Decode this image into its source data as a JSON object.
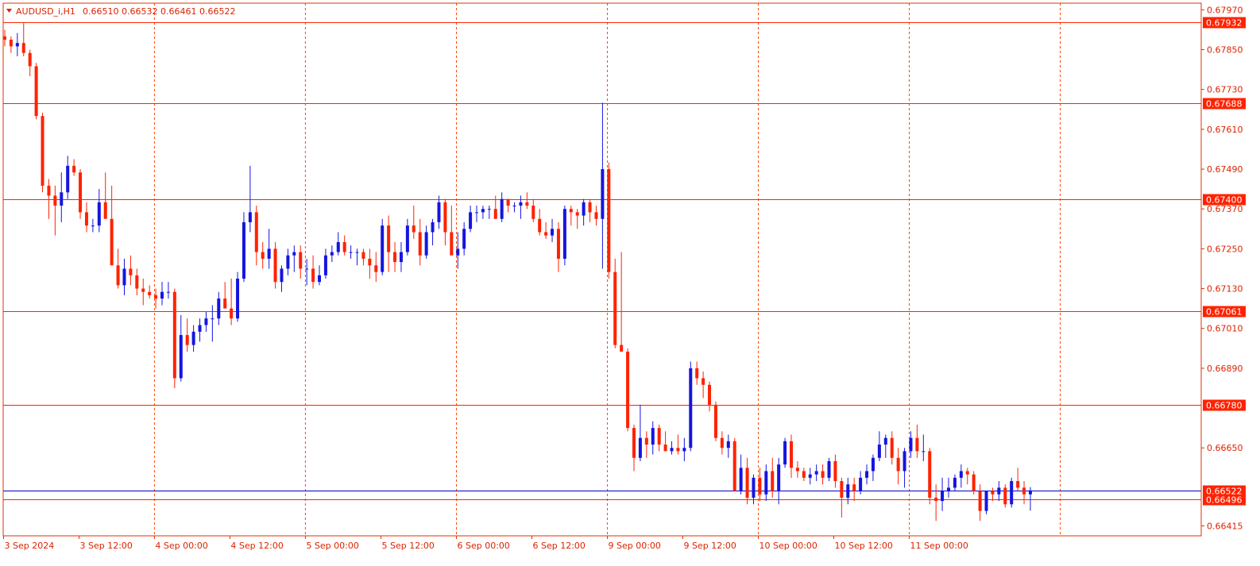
{
  "header": {
    "symbol_label": "AUDUSD_i,H1",
    "ohlc_label": "0.66510 0.66532 0.66461 0.66522"
  },
  "colors": {
    "bull": "#1515e0",
    "bear": "#ff2200",
    "axis_text": "#dd2200",
    "hline": "#ff2200",
    "grid": "#ff4400",
    "bid_line": "#0000cc"
  },
  "chart_data": {
    "type": "candlestick",
    "title": "AUDUSD_i,H1",
    "ylim": [
      0.66385,
      0.6799
    ],
    "x_tick_labels": [
      "3 Sep 2024",
      "3 Sep 12:00",
      "4 Sep 00:00",
      "4 Sep 12:00",
      "5 Sep 00:00",
      "5 Sep 12:00",
      "6 Sep 00:00",
      "6 Sep 12:00",
      "9 Sep 00:00",
      "9 Sep 12:00",
      "10 Sep 00:00",
      "10 Sep 12:00",
      "11 Sep 00:00"
    ],
    "y_tick_labels": [
      "0.67970",
      "0.67850",
      "0.67730",
      "0.67610",
      "0.67490",
      "0.67370",
      "0.67250",
      "0.67130",
      "0.67010",
      "0.66890",
      "0.66650",
      "0.66415"
    ],
    "y_tick_values": [
      0.6797,
      0.6785,
      0.6773,
      0.6761,
      0.6749,
      0.6737,
      0.6725,
      0.6713,
      0.6701,
      0.6689,
      0.6665,
      0.66415
    ],
    "horizontal_levels": [
      {
        "label": "0.67932",
        "value": 0.67932
      },
      {
        "label": "0.67688",
        "value": 0.67688
      },
      {
        "label": "0.67400",
        "value": 0.674
      },
      {
        "label": "0.67061",
        "value": 0.67061
      },
      {
        "label": "0.66780",
        "value": 0.6678
      },
      {
        "label": "0.66496",
        "value": 0.66496
      }
    ],
    "current_price": {
      "label": "0.66522",
      "value": 0.66522
    },
    "candles": [
      [
        0.6789,
        0.6791,
        0.6786,
        0.6788
      ],
      [
        0.6788,
        0.6789,
        0.6784,
        0.6786
      ],
      [
        0.6786,
        0.679,
        0.6783,
        0.6787
      ],
      [
        0.6787,
        0.6793,
        0.6783,
        0.6784
      ],
      [
        0.6784,
        0.6785,
        0.6777,
        0.678
      ],
      [
        0.678,
        0.6781,
        0.6764,
        0.6765
      ],
      [
        0.6765,
        0.6766,
        0.6742,
        0.6744
      ],
      [
        0.6744,
        0.6746,
        0.6734,
        0.6741
      ],
      [
        0.6741,
        0.6744,
        0.6729,
        0.6738
      ],
      [
        0.6738,
        0.6748,
        0.6733,
        0.6742
      ],
      [
        0.6742,
        0.6753,
        0.674,
        0.675
      ],
      [
        0.675,
        0.6752,
        0.6747,
        0.6748
      ],
      [
        0.6748,
        0.6749,
        0.6734,
        0.6736
      ],
      [
        0.6736,
        0.6739,
        0.673,
        0.6732
      ],
      [
        0.6732,
        0.6734,
        0.673,
        0.6732
      ],
      [
        0.6732,
        0.6743,
        0.673,
        0.6739
      ],
      [
        0.6739,
        0.6748,
        0.6738,
        0.6734
      ],
      [
        0.6734,
        0.6744,
        0.673,
        0.672
      ],
      [
        0.672,
        0.6725,
        0.6713,
        0.6714
      ],
      [
        0.6714,
        0.6722,
        0.6711,
        0.6719
      ],
      [
        0.6719,
        0.6723,
        0.6714,
        0.6717
      ],
      [
        0.6717,
        0.6719,
        0.6711,
        0.6713
      ],
      [
        0.6713,
        0.6716,
        0.6708,
        0.6712
      ],
      [
        0.6712,
        0.6714,
        0.671,
        0.6711
      ],
      [
        0.6711,
        0.6713,
        0.6707,
        0.671
      ],
      [
        0.671,
        0.6715,
        0.6708,
        0.6712
      ],
      [
        0.6712,
        0.6715,
        0.671,
        0.6712
      ],
      [
        0.6712,
        0.6713,
        0.6683,
        0.6686
      ],
      [
        0.6686,
        0.6705,
        0.6685,
        0.6699
      ],
      [
        0.6699,
        0.6704,
        0.6694,
        0.6696
      ],
      [
        0.6696,
        0.6702,
        0.6694,
        0.67
      ],
      [
        0.67,
        0.6704,
        0.6697,
        0.6702
      ],
      [
        0.6702,
        0.6706,
        0.67,
        0.6704
      ],
      [
        0.6704,
        0.6708,
        0.6697,
        0.6704
      ],
      [
        0.6704,
        0.6712,
        0.6702,
        0.671
      ],
      [
        0.671,
        0.6715,
        0.6708,
        0.6707
      ],
      [
        0.6707,
        0.6716,
        0.6702,
        0.6704
      ],
      [
        0.6704,
        0.6718,
        0.6703,
        0.6716
      ],
      [
        0.6716,
        0.6736,
        0.6715,
        0.6733
      ],
      [
        0.6733,
        0.675,
        0.673,
        0.6736
      ],
      [
        0.6736,
        0.6738,
        0.672,
        0.6724
      ],
      [
        0.6724,
        0.6727,
        0.6719,
        0.6722
      ],
      [
        0.6722,
        0.6731,
        0.6719,
        0.6725
      ],
      [
        0.6725,
        0.6727,
        0.6713,
        0.6715
      ],
      [
        0.6715,
        0.672,
        0.6712,
        0.6719
      ],
      [
        0.6719,
        0.6725,
        0.6717,
        0.6723
      ],
      [
        0.6723,
        0.6726,
        0.6718,
        0.6724
      ],
      [
        0.6724,
        0.6726,
        0.6716,
        0.6719
      ],
      [
        0.6719,
        0.6722,
        0.6714,
        0.6719
      ],
      [
        0.6719,
        0.6723,
        0.6713,
        0.6715
      ],
      [
        0.6715,
        0.672,
        0.6714,
        0.6717
      ],
      [
        0.6717,
        0.6725,
        0.6716,
        0.6723
      ],
      [
        0.6723,
        0.6726,
        0.6721,
        0.6724
      ],
      [
        0.6724,
        0.673,
        0.6723,
        0.6727
      ],
      [
        0.6727,
        0.6729,
        0.6723,
        0.6724
      ],
      [
        0.6724,
        0.6726,
        0.6722,
        0.6724
      ],
      [
        0.6724,
        0.6725,
        0.672,
        0.6724
      ],
      [
        0.6724,
        0.6725,
        0.672,
        0.6722
      ],
      [
        0.6722,
        0.6725,
        0.6716,
        0.672
      ],
      [
        0.672,
        0.6724,
        0.6715,
        0.6718
      ],
      [
        0.6718,
        0.6734,
        0.6717,
        0.6732
      ],
      [
        0.6732,
        0.6735,
        0.6718,
        0.6724
      ],
      [
        0.6724,
        0.6727,
        0.6718,
        0.6721
      ],
      [
        0.6721,
        0.6727,
        0.6718,
        0.6724
      ],
      [
        0.6724,
        0.6734,
        0.6723,
        0.6732
      ],
      [
        0.6732,
        0.6738,
        0.6728,
        0.673
      ],
      [
        0.673,
        0.6734,
        0.672,
        0.6723
      ],
      [
        0.6723,
        0.6732,
        0.6722,
        0.673
      ],
      [
        0.673,
        0.6734,
        0.6726,
        0.6733
      ],
      [
        0.6733,
        0.6741,
        0.6731,
        0.6739
      ],
      [
        0.6739,
        0.674,
        0.6726,
        0.673
      ],
      [
        0.673,
        0.6738,
        0.6726,
        0.6723
      ],
      [
        0.6723,
        0.673,
        0.6719,
        0.6725
      ],
      [
        0.6725,
        0.6733,
        0.6723,
        0.6731
      ],
      [
        0.6731,
        0.6738,
        0.673,
        0.6736
      ],
      [
        0.6736,
        0.6738,
        0.6733,
        0.6736
      ],
      [
        0.6736,
        0.6738,
        0.6734,
        0.6737
      ],
      [
        0.6737,
        0.6738,
        0.6734,
        0.6737
      ],
      [
        0.6737,
        0.6741,
        0.6734,
        0.6734
      ],
      [
        0.6734,
        0.6742,
        0.6733,
        0.674
      ],
      [
        0.674,
        0.674,
        0.6736,
        0.6738
      ],
      [
        0.6738,
        0.6739,
        0.6736,
        0.6738
      ],
      [
        0.6738,
        0.6741,
        0.6734,
        0.6739
      ],
      [
        0.6739,
        0.6742,
        0.6737,
        0.6738
      ],
      [
        0.6738,
        0.674,
        0.6733,
        0.6734
      ],
      [
        0.6734,
        0.6737,
        0.6729,
        0.673
      ],
      [
        0.673,
        0.6733,
        0.6728,
        0.6729
      ],
      [
        0.6729,
        0.6734,
        0.6727,
        0.6731
      ],
      [
        0.6731,
        0.6733,
        0.6718,
        0.6722
      ],
      [
        0.6722,
        0.6738,
        0.672,
        0.6737
      ],
      [
        0.6737,
        0.6738,
        0.6732,
        0.6736
      ],
      [
        0.6736,
        0.6737,
        0.6731,
        0.6735
      ],
      [
        0.6735,
        0.674,
        0.6732,
        0.6739
      ],
      [
        0.6739,
        0.674,
        0.6733,
        0.6736
      ],
      [
        0.6736,
        0.6738,
        0.6732,
        0.6734
      ],
      [
        0.6734,
        0.6769,
        0.6719,
        0.6749
      ],
      [
        0.6749,
        0.6751,
        0.6716,
        0.6718
      ],
      [
        0.6718,
        0.6722,
        0.6695,
        0.6696
      ],
      [
        0.6696,
        0.6724,
        0.6695,
        0.6694
      ],
      [
        0.6694,
        0.6695,
        0.667,
        0.6671
      ],
      [
        0.6671,
        0.6672,
        0.6658,
        0.6662
      ],
      [
        0.6662,
        0.6678,
        0.6661,
        0.6668
      ],
      [
        0.6668,
        0.667,
        0.6662,
        0.6666
      ],
      [
        0.6666,
        0.6673,
        0.6663,
        0.6671
      ],
      [
        0.6671,
        0.6672,
        0.6664,
        0.6666
      ],
      [
        0.6666,
        0.667,
        0.6664,
        0.6664
      ],
      [
        0.6664,
        0.6667,
        0.6663,
        0.6665
      ],
      [
        0.6665,
        0.6669,
        0.6663,
        0.6664
      ],
      [
        0.6664,
        0.6668,
        0.6661,
        0.6665
      ],
      [
        0.6665,
        0.6691,
        0.6664,
        0.6689
      ],
      [
        0.6689,
        0.6691,
        0.6684,
        0.6686
      ],
      [
        0.6686,
        0.6688,
        0.668,
        0.6684
      ],
      [
        0.6684,
        0.6685,
        0.6676,
        0.6678
      ],
      [
        0.6678,
        0.6679,
        0.6667,
        0.6668
      ],
      [
        0.6668,
        0.667,
        0.6663,
        0.6665
      ],
      [
        0.6665,
        0.6669,
        0.6662,
        0.6667
      ],
      [
        0.6667,
        0.6668,
        0.6653,
        0.6652
      ],
      [
        0.6652,
        0.6663,
        0.6651,
        0.6659
      ],
      [
        0.6659,
        0.6662,
        0.6648,
        0.665
      ],
      [
        0.665,
        0.6657,
        0.6648,
        0.6656
      ],
      [
        0.6656,
        0.6659,
        0.6649,
        0.6651
      ],
      [
        0.6651,
        0.666,
        0.6649,
        0.6658
      ],
      [
        0.6658,
        0.6662,
        0.665,
        0.6652
      ],
      [
        0.6652,
        0.6662,
        0.6648,
        0.666
      ],
      [
        0.666,
        0.6668,
        0.6659,
        0.6667
      ],
      [
        0.6667,
        0.6669,
        0.6656,
        0.6659
      ],
      [
        0.6659,
        0.6661,
        0.6656,
        0.6658
      ],
      [
        0.6658,
        0.6659,
        0.6655,
        0.6656
      ],
      [
        0.6656,
        0.6659,
        0.6654,
        0.6657
      ],
      [
        0.6657,
        0.666,
        0.6655,
        0.6658
      ],
      [
        0.6658,
        0.666,
        0.6654,
        0.6656
      ],
      [
        0.6656,
        0.6662,
        0.6655,
        0.6661
      ],
      [
        0.6661,
        0.6663,
        0.6653,
        0.6655
      ],
      [
        0.6655,
        0.6656,
        0.6644,
        0.665
      ],
      [
        0.665,
        0.6656,
        0.6648,
        0.6654
      ],
      [
        0.6654,
        0.6656,
        0.6649,
        0.6652
      ],
      [
        0.6652,
        0.6658,
        0.6651,
        0.6656
      ],
      [
        0.6656,
        0.666,
        0.6654,
        0.6658
      ],
      [
        0.6658,
        0.6663,
        0.6655,
        0.6662
      ],
      [
        0.6662,
        0.667,
        0.6661,
        0.6666
      ],
      [
        0.6666,
        0.6669,
        0.6662,
        0.6668
      ],
      [
        0.6668,
        0.667,
        0.666,
        0.6662
      ],
      [
        0.6662,
        0.6665,
        0.6654,
        0.6658
      ],
      [
        0.6658,
        0.6665,
        0.6653,
        0.6664
      ],
      [
        0.6664,
        0.667,
        0.6662,
        0.6668
      ],
      [
        0.6668,
        0.6672,
        0.6662,
        0.6664
      ],
      [
        0.6664,
        0.6669,
        0.6661,
        0.6664
      ],
      [
        0.6664,
        0.6665,
        0.6648,
        0.665
      ],
      [
        0.665,
        0.6654,
        0.6643,
        0.6649
      ],
      [
        0.6649,
        0.6656,
        0.6646,
        0.6652
      ],
      [
        0.6652,
        0.6656,
        0.665,
        0.6653
      ],
      [
        0.6653,
        0.6657,
        0.6652,
        0.6656
      ],
      [
        0.6656,
        0.666,
        0.6653,
        0.6658
      ],
      [
        0.6658,
        0.6659,
        0.6654,
        0.6657
      ],
      [
        0.6657,
        0.6658,
        0.6651,
        0.6652
      ],
      [
        0.6652,
        0.6654,
        0.6643,
        0.6646
      ],
      [
        0.6646,
        0.6652,
        0.6645,
        0.6652
      ],
      [
        0.6652,
        0.6653,
        0.6649,
        0.6651
      ],
      [
        0.6651,
        0.6655,
        0.6649,
        0.6653
      ],
      [
        0.6653,
        0.6654,
        0.6647,
        0.6648
      ],
      [
        0.6648,
        0.6656,
        0.6647,
        0.6655
      ],
      [
        0.6655,
        0.6659,
        0.6652,
        0.6653
      ],
      [
        0.6653,
        0.6655,
        0.6648,
        0.6651
      ],
      [
        0.6651,
        0.66532,
        0.66461,
        0.66522
      ]
    ]
  }
}
